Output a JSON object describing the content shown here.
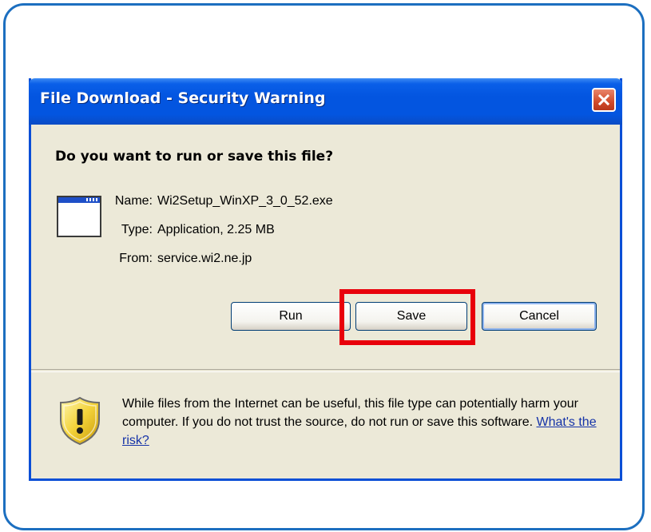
{
  "dialog": {
    "title": "File Download - Security Warning",
    "question": "Do you want to run or save this file?",
    "file": {
      "name_label": "Name:",
      "name_value": "Wi2Setup_WinXP_3_0_52.exe",
      "type_label": "Type:",
      "type_value": "Application, 2.25 MB",
      "from_label": "From:",
      "from_value": "service.wi2.ne.jp"
    },
    "buttons": {
      "run": "Run",
      "save": "Save",
      "cancel": "Cancel"
    },
    "warning": {
      "text": "While files from the Internet can be useful, this file type can potentially harm your computer. If you do not trust the source, do not run or save this software. ",
      "link": "What's the risk?"
    }
  },
  "icons": {
    "close": "close-icon",
    "application": "application-window-icon",
    "warning": "shield-warning-icon"
  },
  "colors": {
    "frame_border": "#1c6fc0",
    "titlebar": "#0355e0",
    "dialog_bg": "#ece9d8",
    "highlight": "#e8000b",
    "link": "#1533a8"
  }
}
